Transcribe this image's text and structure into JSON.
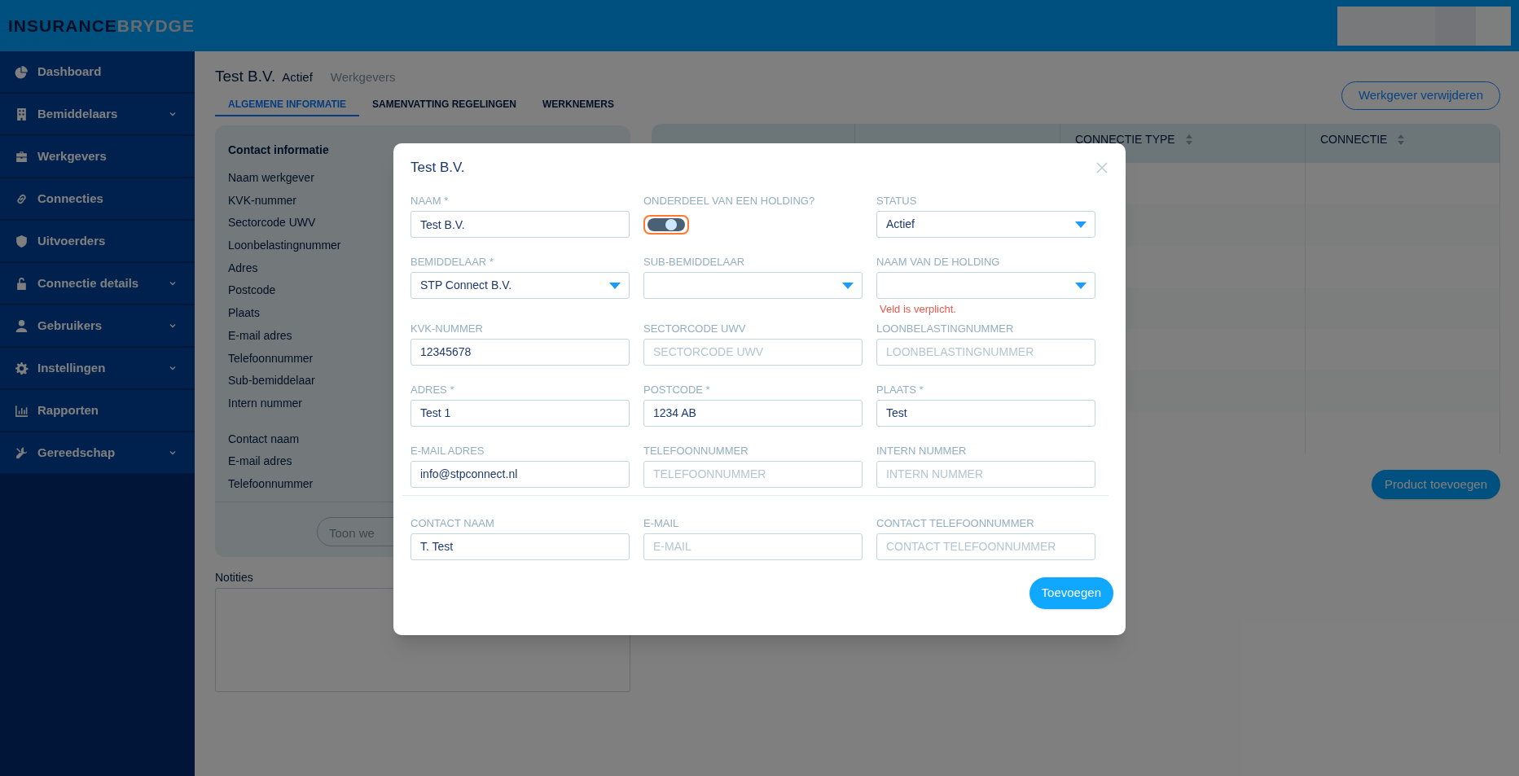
{
  "logo": {
    "primary": "INSURANCE",
    "secondary": "BRYDGE"
  },
  "sidebar": {
    "items": [
      {
        "label": "Dashboard",
        "kind": "link"
      },
      {
        "label": "Bemiddelaars",
        "kind": "group"
      },
      {
        "label": "Werkgevers",
        "kind": "link"
      },
      {
        "label": "Connecties",
        "kind": "link"
      },
      {
        "label": "Uitvoerders",
        "kind": "link"
      },
      {
        "label": "Connectie details",
        "kind": "group"
      },
      {
        "label": "Gebruikers",
        "kind": "group"
      },
      {
        "label": "Instellingen",
        "kind": "group"
      },
      {
        "label": "Rapporten",
        "kind": "link"
      },
      {
        "label": "Gereedschap",
        "kind": "group"
      }
    ]
  },
  "page": {
    "title": "Test B.V.",
    "status": "Actief",
    "breadcrumb": "Werkgevers",
    "tabs": [
      {
        "label": "ALGEMENE INFORMATIE",
        "selected": true
      },
      {
        "label": "SAMENVATTING REGELINGEN",
        "selected": false
      },
      {
        "label": "WERKNEMERS",
        "selected": false
      }
    ],
    "delete_button": "Werkgever verwijderen",
    "contact_card": {
      "heading": "Contact informatie",
      "groups": [
        [
          "Naam werkgever",
          "KVK-nummer",
          "Sectorcode UWV",
          "Loonbelastingnummer",
          "Adres",
          "Postcode",
          "Plaats",
          "E-mail adres",
          "Telefoonnummer",
          "Sub-bemiddelaar",
          "Intern nummer"
        ],
        [
          "Contact naam",
          "E-mail adres",
          "Telefoonnummer"
        ]
      ],
      "button": "Toon we"
    },
    "notes_label": "Notities",
    "table": {
      "columns": [
        "CONNECTIE TYPE",
        "CONNECTIE"
      ]
    },
    "add_product_button": "Product toevoegen"
  },
  "modal": {
    "title": "Test B.V.",
    "sections": [
      {
        "rows": [
          [
            {
              "label": "NAAM *",
              "kind": "text",
              "value": "Test B.V."
            },
            {
              "label": "ONDERDEEL VAN EEN HOLDING?",
              "kind": "toggle",
              "on": true,
              "focused": true
            },
            {
              "label": "STATUS",
              "kind": "select",
              "value": "Actief"
            }
          ],
          [
            {
              "label": "BEMIDDELAAR *",
              "kind": "select",
              "value": "STP Connect B.V."
            },
            {
              "label": "SUB-BEMIDDELAAR",
              "kind": "select"
            },
            {
              "label": "NAAM VAN DE HOLDING",
              "kind": "select",
              "error": "Veld is verplicht."
            }
          ],
          [
            {
              "label": "KVK-NUMMER",
              "kind": "text",
              "value": "12345678"
            },
            {
              "label": "SECTORCODE UWV",
              "kind": "text",
              "placeholder": "SECTORCODE UWV"
            },
            {
              "label": "LOONBELASTINGNUMMER",
              "kind": "text",
              "placeholder": "LOONBELASTINGNUMMER"
            }
          ],
          [
            {
              "label": "ADRES *",
              "kind": "text",
              "value": "Test 1"
            },
            {
              "label": "POSTCODE *",
              "kind": "text",
              "value": "1234 AB"
            },
            {
              "label": "PLAATS *",
              "kind": "text",
              "value": "Test"
            }
          ],
          [
            {
              "label": "E-MAIL ADRES",
              "kind": "text",
              "value": "info@stpconnect.nl"
            },
            {
              "label": "TELEFOONNUMMER",
              "kind": "text",
              "placeholder": "TELEFOONNUMMER"
            },
            {
              "label": "INTERN NUMMER",
              "kind": "text",
              "placeholder": "INTERN NUMMER"
            }
          ]
        ]
      },
      {
        "rows": [
          [
            {
              "label": "CONTACT NAAM",
              "kind": "text",
              "value": "T. Test"
            },
            {
              "label": "E-MAIL",
              "kind": "text",
              "placeholder": "E-MAIL"
            },
            {
              "label": "CONTACT TELEFOONNUMMER",
              "kind": "text",
              "placeholder": "CONTACT TELEFOONNUMMER"
            }
          ]
        ]
      }
    ],
    "submit_button": "Toevoegen"
  }
}
